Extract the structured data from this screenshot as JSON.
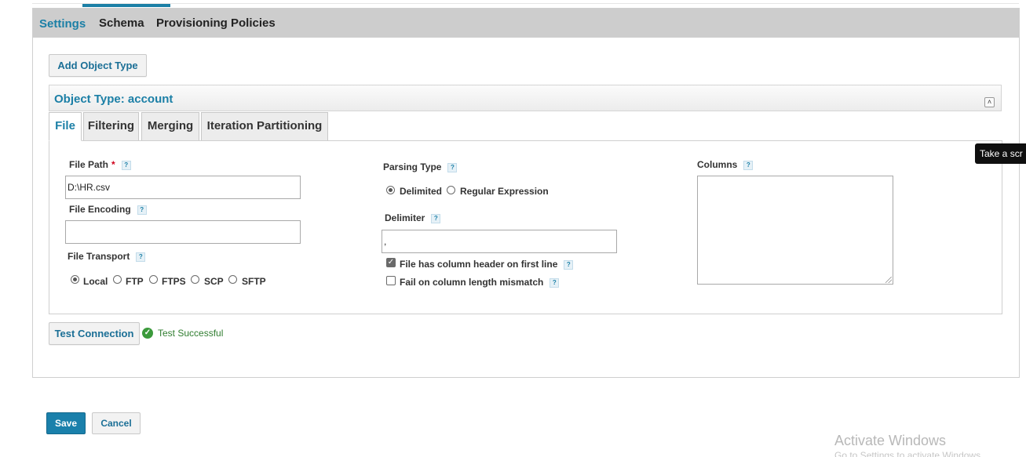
{
  "top_tabs": [
    "Settings",
    "Schema",
    "Provisioning Policies"
  ],
  "add_object_type_label": "Add Object Type",
  "object_type": {
    "title": "Object Type: account"
  },
  "sub_tabs": [
    "File",
    "Filtering",
    "Merging",
    "Iteration Partitioning"
  ],
  "file_path": {
    "label": "File Path",
    "required_mark": "*",
    "value": "D:\\HR.csv"
  },
  "file_encoding": {
    "label": "File Encoding",
    "value": ""
  },
  "file_transport": {
    "label": "File Transport",
    "options": [
      "Local",
      "FTP",
      "FTPS",
      "SCP",
      "SFTP"
    ],
    "selected": "Local"
  },
  "parsing_type": {
    "label": "Parsing Type",
    "options": [
      "Delimited",
      "Regular Expression"
    ],
    "selected": "Delimited"
  },
  "delimiter": {
    "label": "Delimiter",
    "value": ","
  },
  "checkboxes": [
    {
      "label": "File has column header on first line",
      "checked": true
    },
    {
      "label": "Fail on column length mismatch",
      "checked": false
    }
  ],
  "columns": {
    "label": "Columns",
    "value": ""
  },
  "help_icon_text": "?",
  "test_connection_label": "Test Connection",
  "test_status": "Test Successful",
  "save_label": "Save",
  "cancel_label": "Cancel",
  "tooltip": "Take a scr",
  "watermark": {
    "title": "Activate Windows",
    "subtitle": "Go to Settings to activate Windows."
  },
  "colors": {
    "accent": "#1b7fa6",
    "save_button": "#1a80ab",
    "success": "#3c9a3c"
  }
}
